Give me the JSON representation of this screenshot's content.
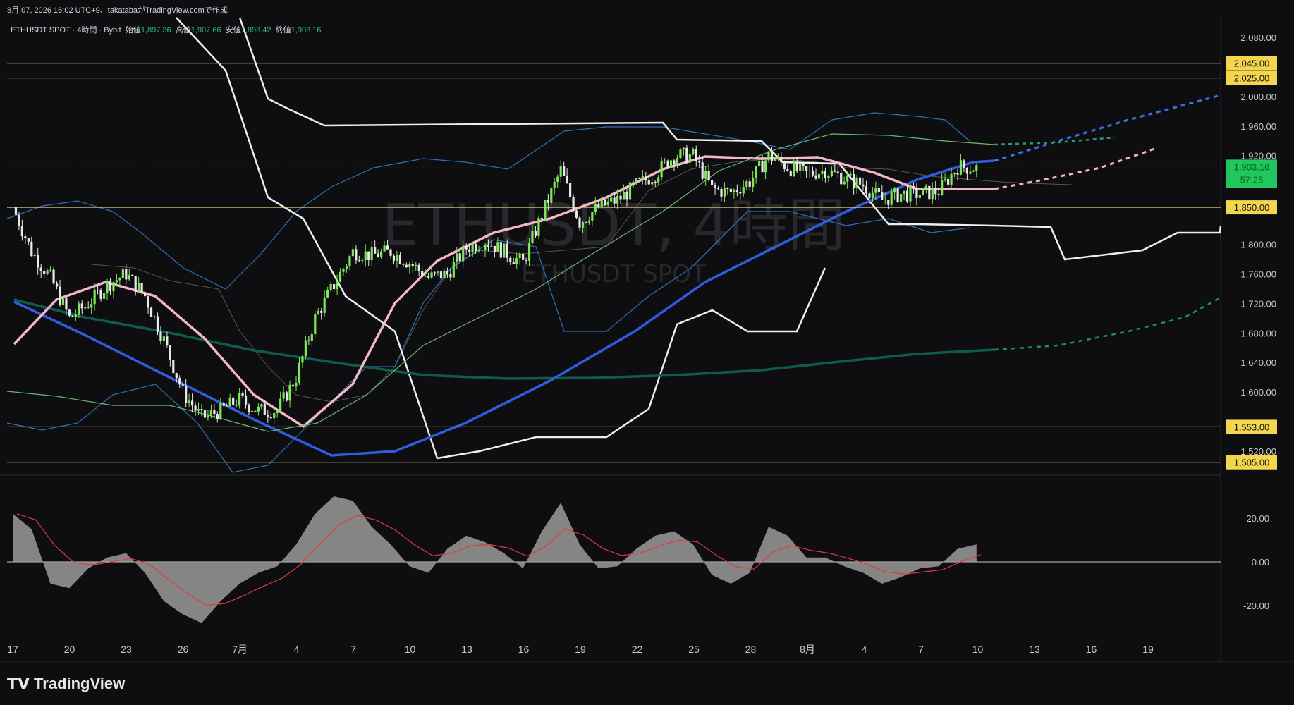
{
  "header": {
    "created_line": "8月 07, 2026 16:02 UTC+9、takatabaがTradingView.comで作成"
  },
  "legend": {
    "symbol": "ETHUSDT SPOT · 4時間 · Bybit",
    "open_label": "始値",
    "open": "1,897.36",
    "high_label": "高値",
    "high": "1,907.66",
    "low_label": "安値",
    "low": "1,893.42",
    "close_label": "終値",
    "close": "1,903.16"
  },
  "watermark": {
    "line1": "ETHUSDT, 4時間",
    "line2": "ETHUSDT SPOT"
  },
  "brand": {
    "name": "TradingView"
  },
  "colors": {
    "bg": "#0e0e10",
    "up": "#7ee65a",
    "down": "#e8e8e8",
    "ma_blue": "#2f5de0",
    "ma_teal": "#0f5c4c",
    "ma_pink": "#f2b6c6",
    "level": "#e6d28c",
    "price_badge": "#22c55e"
  },
  "chart_data": {
    "type": "candlestick",
    "symbol": "ETHUSDT SPOT",
    "timeframe": "4時間",
    "exchange": "Bybit",
    "price_axis": {
      "ticks": [
        2080,
        2000,
        1960,
        1920,
        1800,
        1760,
        1720,
        1680,
        1640,
        1600,
        1520
      ],
      "tick_labels": [
        "2,080.00",
        "2,000.00",
        "1,960.00",
        "1,920.00",
        "1,800.00",
        "1,760.00",
        "1,720.00",
        "1,680.00",
        "1,640.00",
        "1,600.00",
        "1,520.00"
      ],
      "range": [
        1505,
        2100
      ]
    },
    "horizontal_levels": [
      {
        "value": 2045,
        "label": "2,045.00"
      },
      {
        "value": 2025,
        "label": "2,025.00"
      },
      {
        "value": 1850,
        "label": "1,850.00"
      },
      {
        "value": 1553,
        "label": "1,553.00"
      },
      {
        "value": 1505,
        "label": "1,505.00"
      }
    ],
    "last_price": {
      "value": 1903.16,
      "label": "1,903.16",
      "countdown": "57:25"
    },
    "time_axis": {
      "labels": [
        "17",
        "20",
        "23",
        "26",
        "7月",
        "4",
        "7",
        "10",
        "13",
        "16",
        "19",
        "22",
        "25",
        "28",
        "8月",
        "4",
        "7",
        "10",
        "13",
        "16",
        "19"
      ]
    },
    "close_path": [
      [
        "06-17",
        1850
      ],
      [
        "06-18",
        1790
      ],
      [
        "06-19",
        1755
      ],
      [
        "06-20",
        1700
      ],
      [
        "06-21",
        1720
      ],
      [
        "06-22",
        1745
      ],
      [
        "06-23",
        1760
      ],
      [
        "06-24",
        1730
      ],
      [
        "06-25",
        1670
      ],
      [
        "06-26",
        1600
      ],
      [
        "06-27",
        1565
      ],
      [
        "06-28",
        1575
      ],
      [
        "06-29",
        1590
      ],
      [
        "06-30",
        1575
      ],
      [
        "07-01",
        1575
      ],
      [
        "07-02",
        1620
      ],
      [
        "07-03",
        1700
      ],
      [
        "07-04",
        1745
      ],
      [
        "07-05",
        1790
      ],
      [
        "07-06",
        1785
      ],
      [
        "07-07",
        1790
      ],
      [
        "07-08",
        1775
      ],
      [
        "07-09",
        1755
      ],
      [
        "07-10",
        1760
      ],
      [
        "07-11",
        1795
      ],
      [
        "07-12",
        1805
      ],
      [
        "07-13",
        1790
      ],
      [
        "07-14",
        1775
      ],
      [
        "07-15",
        1840
      ],
      [
        "07-16",
        1900
      ],
      [
        "07-17",
        1830
      ],
      [
        "07-18",
        1850
      ],
      [
        "07-19",
        1860
      ],
      [
        "07-20",
        1880
      ],
      [
        "07-21",
        1895
      ],
      [
        "07-22",
        1920
      ],
      [
        "07-23",
        1920
      ],
      [
        "07-24",
        1875
      ],
      [
        "07-25",
        1870
      ],
      [
        "07-26",
        1885
      ],
      [
        "07-27",
        1920
      ],
      [
        "07-28",
        1905
      ],
      [
        "07-29",
        1895
      ],
      [
        "07-30",
        1900
      ],
      [
        "07-31",
        1890
      ],
      [
        "08-01",
        1880
      ],
      [
        "08-02",
        1860
      ],
      [
        "08-03",
        1868
      ],
      [
        "08-04",
        1868
      ],
      [
        "08-05",
        1872
      ],
      [
        "08-06",
        1905
      ],
      [
        "08-07",
        1903.16
      ]
    ],
    "oscillator": {
      "ticks": [
        20,
        0,
        -20
      ],
      "tick_labels": [
        "20.00",
        "0.00",
        "-20.00"
      ],
      "histogram": [
        [
          "06-17",
          22
        ],
        [
          "06-18",
          15
        ],
        [
          "06-19",
          -10
        ],
        [
          "06-20",
          -12
        ],
        [
          "06-21",
          -3
        ],
        [
          "06-22",
          2
        ],
        [
          "06-23",
          4
        ],
        [
          "06-24",
          -5
        ],
        [
          "06-25",
          -18
        ],
        [
          "06-26",
          -24
        ],
        [
          "06-27",
          -28
        ],
        [
          "06-28",
          -18
        ],
        [
          "06-29",
          -10
        ],
        [
          "06-30",
          -5
        ],
        [
          "07-01",
          -2
        ],
        [
          "07-02",
          8
        ],
        [
          "07-03",
          22
        ],
        [
          "07-04",
          30
        ],
        [
          "07-05",
          28
        ],
        [
          "07-06",
          16
        ],
        [
          "07-07",
          8
        ],
        [
          "07-08",
          -2
        ],
        [
          "07-09",
          -5
        ],
        [
          "07-10",
          6
        ],
        [
          "07-11",
          12
        ],
        [
          "07-12",
          9
        ],
        [
          "07-13",
          4
        ],
        [
          "07-14",
          -3
        ],
        [
          "07-15",
          14
        ],
        [
          "07-16",
          27
        ],
        [
          "07-17",
          8
        ],
        [
          "07-18",
          -3
        ],
        [
          "07-19",
          -2
        ],
        [
          "07-20",
          6
        ],
        [
          "07-21",
          12
        ],
        [
          "07-22",
          14
        ],
        [
          "07-23",
          8
        ],
        [
          "07-24",
          -6
        ],
        [
          "07-25",
          -10
        ],
        [
          "07-26",
          -5
        ],
        [
          "07-27",
          16
        ],
        [
          "07-28",
          12
        ],
        [
          "07-29",
          2
        ],
        [
          "07-30",
          2
        ],
        [
          "07-31",
          -2
        ],
        [
          "08-01",
          -5
        ],
        [
          "08-02",
          -10
        ],
        [
          "08-03",
          -7
        ],
        [
          "08-04",
          -3
        ],
        [
          "08-05",
          -2
        ],
        [
          "08-06",
          6
        ],
        [
          "08-07",
          8
        ]
      ]
    }
  }
}
